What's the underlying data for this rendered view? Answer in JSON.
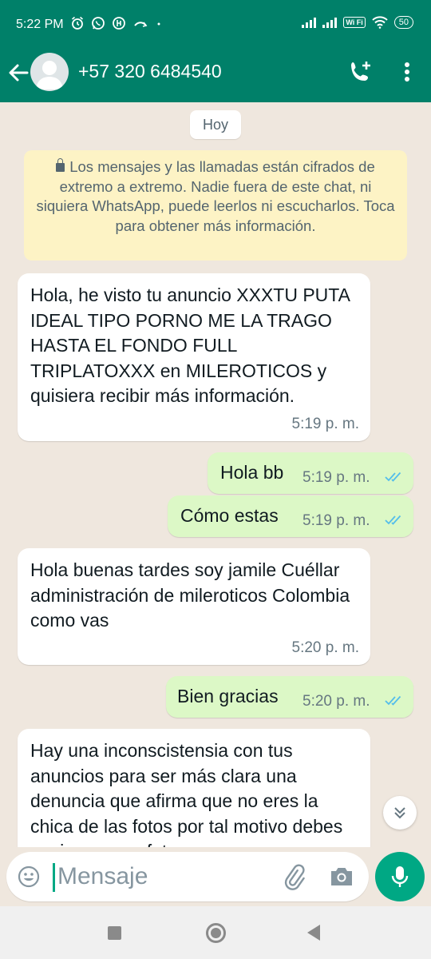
{
  "status_bar": {
    "time": "5:22 PM",
    "left_icons": [
      "alarm-icon",
      "whatsapp-icon",
      "app-icon",
      "missed-call-icon",
      "dot-icon"
    ],
    "wifi_label": "Wi Fi",
    "battery": "50"
  },
  "header": {
    "contact_name": "+57 320 6484540",
    "icons": [
      "back-arrow-icon",
      "avatar-icon",
      "add-call-icon",
      "more-vert-icon"
    ]
  },
  "chat": {
    "date_label": "Hoy",
    "encryption_notice": "Los mensajes y las llamadas están cifrados de extremo a extremo. Nadie fuera de este chat, ni siquiera WhatsApp, puede leerlos ni escucharlos. Toca para obtener más información.",
    "messages": [
      {
        "direction": "in",
        "text": "Hola, he visto tu anuncio XXXTU PUTA IDEAL TIPO PORNO ME LA TRAGO HASTA EL FONDO FULL TRIPLATOXXX en MILEROTICOS y quisiera recibir más información.",
        "time": "5:19 p. m."
      },
      {
        "direction": "out",
        "text": "Hola bb",
        "time": "5:19 p. m.",
        "status": "read"
      },
      {
        "direction": "out",
        "text": "Cómo estas",
        "time": "5:19 p. m.",
        "status": "read"
      },
      {
        "direction": "in",
        "text": "Hola buenas tardes soy jamile Cuéllar administración de mileroticos Colombia como vas",
        "time": "5:20 p. m."
      },
      {
        "direction": "out",
        "text": "Bien gracias",
        "time": "5:20 p. m.",
        "status": "read"
      },
      {
        "direction": "in",
        "text": "Hay una inconscistensia con tus anuncios para ser más clara una denuncia que afirma que no eres la chica de las fotos por tal motivo debes enviarme una foto",
        "time": ""
      }
    ]
  },
  "composer": {
    "placeholder": "Mensaje",
    "icons": [
      "emoji-icon",
      "attach-icon",
      "camera-icon",
      "mic-icon"
    ]
  },
  "colors": {
    "header": "#008069",
    "accent": "#00a884",
    "outgoing_bubble": "#dcf8c6",
    "incoming_bubble": "#ffffff",
    "read_ticks": "#53bdeb",
    "chat_background": "#efe7de"
  }
}
